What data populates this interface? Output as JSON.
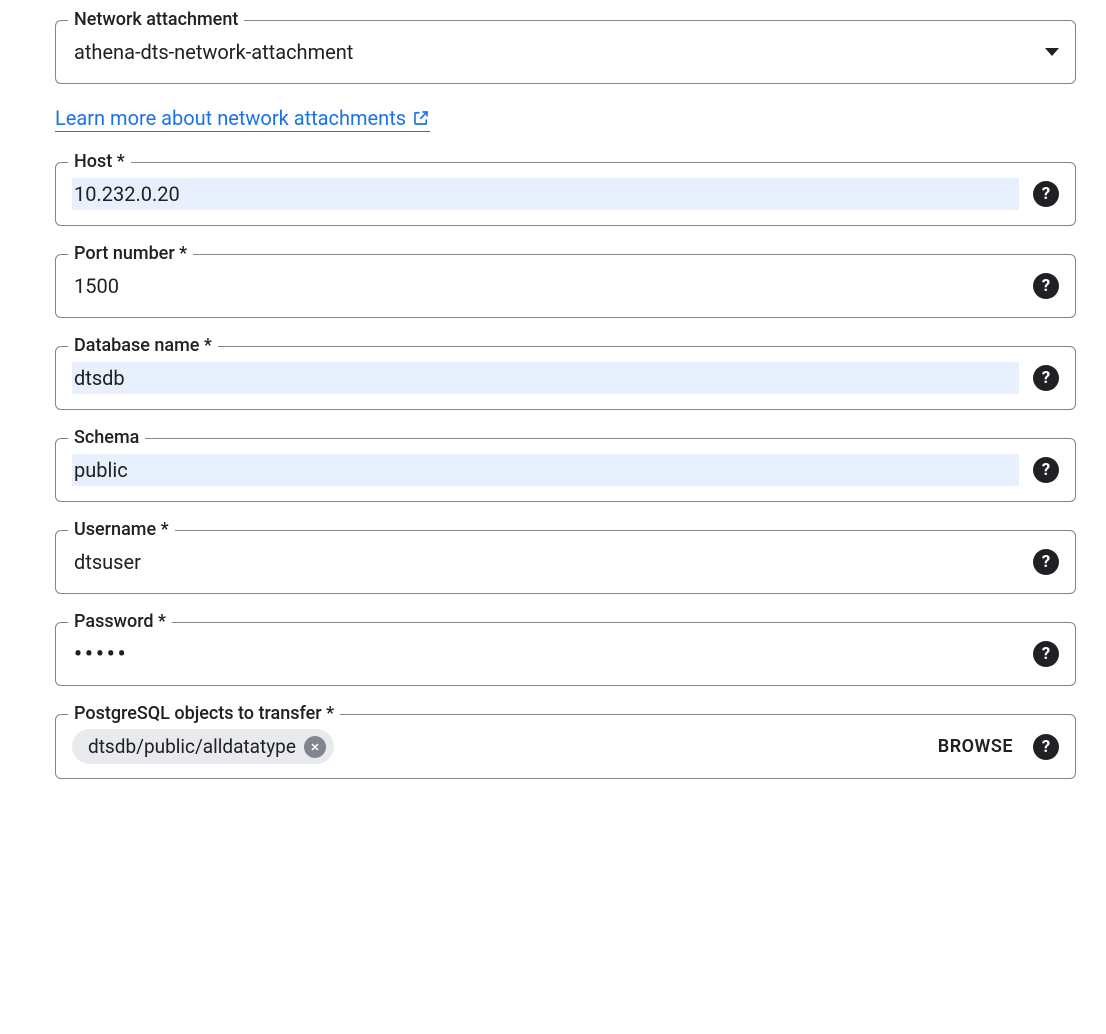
{
  "networkAttachment": {
    "label": "Network attachment",
    "value": "athena-dts-network-attachment"
  },
  "learnMoreLink": {
    "text": "Learn more about network attachments"
  },
  "host": {
    "label": "Host *",
    "value": "10.232.0.20"
  },
  "port": {
    "label": "Port number *",
    "value": "1500"
  },
  "database": {
    "label": "Database name *",
    "value": "dtsdb"
  },
  "schema": {
    "label": "Schema",
    "value": "public"
  },
  "username": {
    "label": "Username *",
    "value": "dtsuser"
  },
  "password": {
    "label": "Password *",
    "value": "•••••"
  },
  "objects": {
    "label": "PostgreSQL objects to transfer *",
    "chip": "dtsdb/public/alldatatype",
    "browse": "BROWSE"
  }
}
